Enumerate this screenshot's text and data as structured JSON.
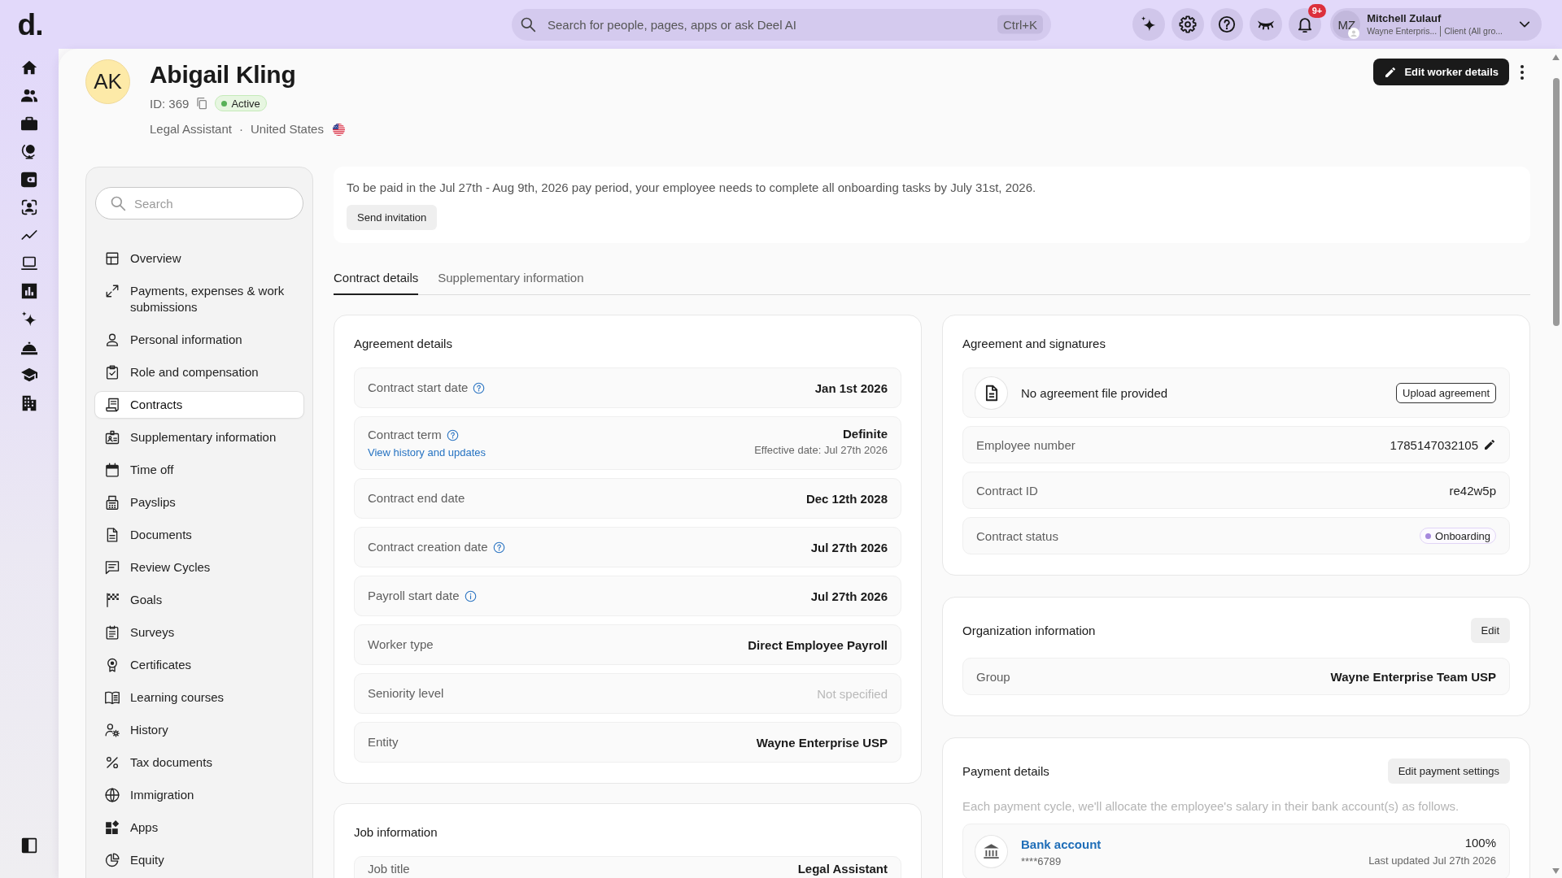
{
  "topbar": {
    "logo": "d.",
    "search": {
      "placeholder": "Search for people, pages, apps or ask Deel AI",
      "shortcut": "Ctrl+K"
    },
    "notifications": {
      "badge": "9+"
    },
    "user": {
      "initials": "MZ",
      "name": "Mitchell Zulauf",
      "company": "Wayne Enterpris...",
      "role": "Client (All gro..."
    }
  },
  "profile": {
    "initials": "AK",
    "name": "Abigail Kling",
    "id": "ID: 369",
    "status": {
      "label": "Active",
      "color": "#58b158"
    },
    "job_title": "Legal Assistant",
    "separator": "·",
    "country": "United States",
    "edit_button": "Edit worker details"
  },
  "sidebar": {
    "search": {
      "placeholder": "Search"
    },
    "items": [
      {
        "label": "Overview",
        "selected": false
      },
      {
        "label": "Payments, expenses & work submissions",
        "selected": false
      },
      {
        "label": "Personal information",
        "selected": false
      },
      {
        "label": "Role and compensation",
        "selected": false
      },
      {
        "label": "Contracts",
        "selected": true
      },
      {
        "label": "Supplementary information",
        "selected": false
      },
      {
        "label": "Time off",
        "selected": false
      },
      {
        "label": "Payslips",
        "selected": false
      },
      {
        "label": "Documents",
        "selected": false
      },
      {
        "label": "Review Cycles",
        "selected": false
      },
      {
        "label": "Goals",
        "selected": false
      },
      {
        "label": "Surveys",
        "selected": false
      },
      {
        "label": "Certificates",
        "selected": false
      },
      {
        "label": "Learning courses",
        "selected": false
      },
      {
        "label": "History",
        "selected": false
      },
      {
        "label": "Tax documents",
        "selected": false
      },
      {
        "label": "Immigration",
        "selected": false
      },
      {
        "label": "Apps",
        "selected": false
      },
      {
        "label": "Equity",
        "selected": false
      }
    ]
  },
  "banner": {
    "message": "To be paid in the Jul 27th - Aug 9th, 2026 pay period, your employee needs to complete all onboarding tasks by July 31st, 2026.",
    "button": "Send invitation"
  },
  "tabs": [
    {
      "label": "Contract details",
      "selected": true
    },
    {
      "label": "Supplementary information",
      "selected": false
    }
  ],
  "agreement_details": {
    "title": "Agreement details",
    "rows": [
      {
        "kind": "help",
        "label": "Contract start date",
        "value": "Jan 1st 2026",
        "muted": false
      },
      {
        "kind": "help",
        "label": "Contract term",
        "value": "Definite",
        "link": "View history and updates",
        "note": "Effective date: Jul 27th 2026",
        "muted": false
      },
      {
        "kind": "plain",
        "label": "Contract end date",
        "value": "Dec 12th 2028",
        "muted": false
      },
      {
        "kind": "help",
        "label": "Contract creation date",
        "value": "Jul 27th 2026",
        "muted": false
      },
      {
        "kind": "info",
        "label": "Payroll start date",
        "value": "Jul 27th 2026",
        "muted": false
      },
      {
        "kind": "plain",
        "label": "Worker type",
        "value": "Direct Employee Payroll",
        "muted": false
      },
      {
        "kind": "plain",
        "label": "Seniority level",
        "value": "Not specified",
        "muted": true
      },
      {
        "kind": "plain",
        "label": "Entity",
        "value": "Wayne Enterprise USP",
        "muted": false
      }
    ]
  },
  "job_information": {
    "title": "Job information",
    "rows": [
      {
        "label": "Job title",
        "value": "Legal Assistant",
        "muted": false
      }
    ]
  },
  "agreement_and_signatures": {
    "title": "Agreement and signatures",
    "file": {
      "text": "No agreement file provided",
      "button": "Upload agreement"
    },
    "rows": [
      {
        "kind": "text",
        "label": "Employee number",
        "value": "1785147032105",
        "editable": true
      },
      {
        "kind": "text",
        "label": "Contract ID",
        "value": "re42w5p",
        "editable": false
      },
      {
        "kind": "status",
        "label": "Contract status",
        "value": "Onboarding",
        "color": "#a689dd"
      }
    ]
  },
  "organization_information": {
    "title": "Organization information",
    "button": "Edit",
    "rows": [
      {
        "label": "Group",
        "value": "Wayne Enterprise Team USP"
      }
    ]
  },
  "payment_details": {
    "title": "Payment details",
    "button": "Edit payment settings",
    "description": "Each payment cycle, we'll allocate the employee's salary in their bank account(s) as follows.",
    "accounts": [
      {
        "name": "Bank account",
        "number": "****6789",
        "share": "100%",
        "updated": "Last updated Jul 27th 2026"
      }
    ]
  }
}
